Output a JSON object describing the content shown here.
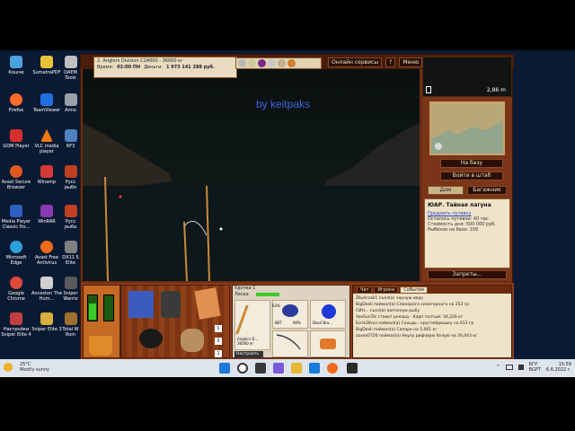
{
  "desktop": {
    "icons": [
      {
        "label": "Кошче",
        "color": "#4aa3e0"
      },
      {
        "label": "SumatraPDF",
        "color": "#e8c23a"
      },
      {
        "label": "Firefox",
        "color": "#ff6a2a"
      },
      {
        "label": "TeamViewer",
        "color": "#1f6fe0"
      },
      {
        "label": "GOM Player",
        "color": "#d63030"
      },
      {
        "label": "VLC media player",
        "color": "#f07a10"
      },
      {
        "label": "Avast Secure Browser",
        "color": "#e05a20"
      },
      {
        "label": "Winamp",
        "color": "#d43a3a"
      },
      {
        "label": "Media Player Classic Ho...",
        "color": "#2c5fbf"
      },
      {
        "label": "WinRAR",
        "color": "#8a3ab0"
      },
      {
        "label": "Microsoft Edge",
        "color": "#2aa0d8"
      },
      {
        "label": "Avast Free Antivirus",
        "color": "#ef6a1a"
      },
      {
        "label": "Google Chrome",
        "color": "#e04a3a"
      },
      {
        "label": "Anceston The Hum...",
        "color": "#d0d0d0"
      },
      {
        "label": "Настройки Sniper Elite 4",
        "color": "#c04040"
      },
      {
        "label": "Sniper Elite 3",
        "color": "#d8b040"
      }
    ],
    "partial_icons": [
      {
        "label": "DAEM Tools",
        "color": "#c0c0c0"
      },
      {
        "label": "Anno",
        "color": "#9aa0a8"
      },
      {
        "label": "RF3",
        "color": "#5080c0"
      },
      {
        "label": "Русс рыбо",
        "color": "#c04020"
      },
      {
        "label": "Русс рыба",
        "color": "#c04020"
      },
      {
        "label": "DX11 S Elite",
        "color": "#808080"
      },
      {
        "label": "Sniper Warrio",
        "color": "#5a5a5a"
      },
      {
        "label": "Total W Rom",
        "color": "#a07030"
      }
    ]
  },
  "game": {
    "info": {
      "line1": "2. Anglers Division C24000 - 36000 кг",
      "time_label": "Время:",
      "time_value": "02:00 ПН",
      "money_label": "Деньги:",
      "money_value": "1 973 141 288 руб."
    },
    "top_buttons": {
      "services": "Онлайн сервисы",
      "help": "?",
      "menu": "Меню"
    },
    "watermark": "by keitpaks",
    "depth": {
      "value": "2,86 m"
    },
    "right_buttons": {
      "to_base": "На базу",
      "to_hq": "Войти в штаб",
      "home": "Дом",
      "trunk": "Багажник"
    },
    "location": {
      "title": "ЮАР. Тайная лагуна",
      "link": "Продлить путевку",
      "left": "Осталось путевки: 40 час.",
      "price": "Стоимость дня: 500 000 руб.",
      "fish_base": "Рыбёхов на базе: 100"
    },
    "bans": "Запреты...",
    "tackle": {
      "hdr1": "Удочка 1",
      "hdr2": "Леска",
      "setup": "Настроить",
      "rod_name": "Anglers D... 36000 кг",
      "reel_pct": "63%",
      "line_label": "Devil Bra...",
      "drag1": "887",
      "drag2": "90%"
    },
    "inventory": {
      "count1": "1",
      "count2": "3",
      "count3": "1"
    },
    "chat": {
      "tabs": [
        "Чат",
        "Игроки",
        "События"
      ],
      "lines": [
        "Zbyliccak1 съел(а) черную икру",
        "BigDeali поймал(а) Спинорога синегорного на 353 гр",
        "СИН... съел(а) копченую рыбу",
        "VoxSunTik ставит рекорд - Карп толтый: 34,226 кг",
        "Бaтk39rus поймал(а) Сельдь - круглобрюшку на 613 гр",
        "BigDeali поймал(а) Сапара на 5,061 кг",
        "zaxeх0726 поймал(а) Акулу рифовую белую на 26,443 кг"
      ]
    }
  },
  "taskbar": {
    "weather_temp": "25°C",
    "weather_text": "Mostly sunny",
    "lang": "БГР",
    "lang2": "BGPT",
    "time": "15:59",
    "date": "6.6.2022 г."
  },
  "colors": {
    "wood": "#6b2d12",
    "watermark": "#3b64e0",
    "taskbar": "#dde4ee"
  }
}
